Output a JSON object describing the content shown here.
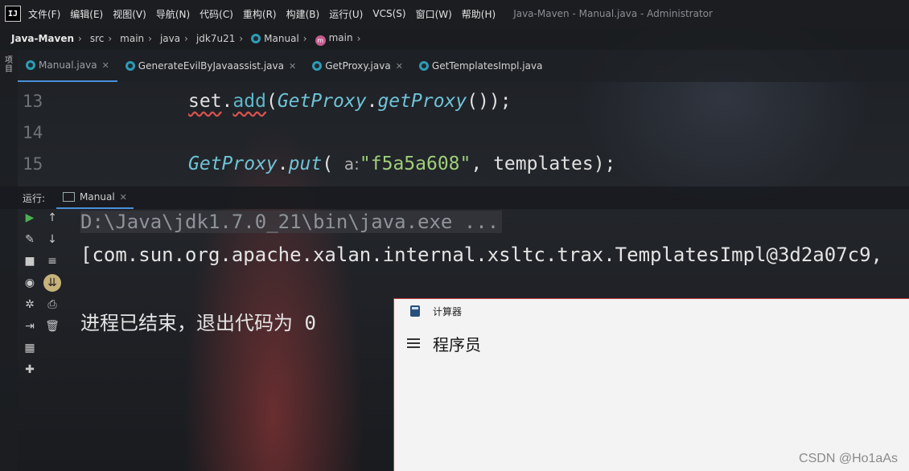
{
  "app": {
    "logo_text": "IJ",
    "window_title": "Java-Maven - Manual.java - Administrator"
  },
  "menu": [
    "文件(F)",
    "编辑(E)",
    "视图(V)",
    "导航(N)",
    "代码(C)",
    "重构(R)",
    "构建(B)",
    "运行(U)",
    "VCS(S)",
    "窗口(W)",
    "帮助(H)"
  ],
  "breadcrumb": [
    "Java-Maven",
    "src",
    "main",
    "java",
    "jdk7u21",
    "Manual",
    "main"
  ],
  "left_strip_label": "项目",
  "tabs": [
    {
      "label": "Manual.java",
      "active": true
    },
    {
      "label": "GenerateEvilByJavaassist.java",
      "active": false
    },
    {
      "label": "GetProxy.java",
      "active": false
    },
    {
      "label": "GetTemplatesImpl.java",
      "active": false
    }
  ],
  "editor": {
    "line_numbers": [
      "13",
      "14",
      "15"
    ],
    "line13": {
      "var": "set",
      "dot": ".",
      "method": "add",
      "open": "(",
      "cls": "GetProxy",
      "dot2": ".",
      "call": "getProxy",
      "close": "());"
    },
    "line15": {
      "cls": "GetProxy",
      "dot": ".",
      "call": "put",
      "open": "(",
      "hint": "a:",
      "str": "\"f5a5a608\"",
      "rest": ", templates);"
    }
  },
  "run": {
    "label": "运行:",
    "tab": "Manual",
    "console_lines": [
      "D:\\Java\\jdk1.7.0_21\\bin\\java.exe ...",
      "[com.sun.org.apache.xalan.internal.xsltc.trax.TemplatesImpl@3d2a07c9,",
      "",
      "进程已结束，退出代码为 0"
    ]
  },
  "calculator": {
    "title": "计算器",
    "mode": "程序员"
  },
  "watermark": "CSDN @Ho1aAs"
}
